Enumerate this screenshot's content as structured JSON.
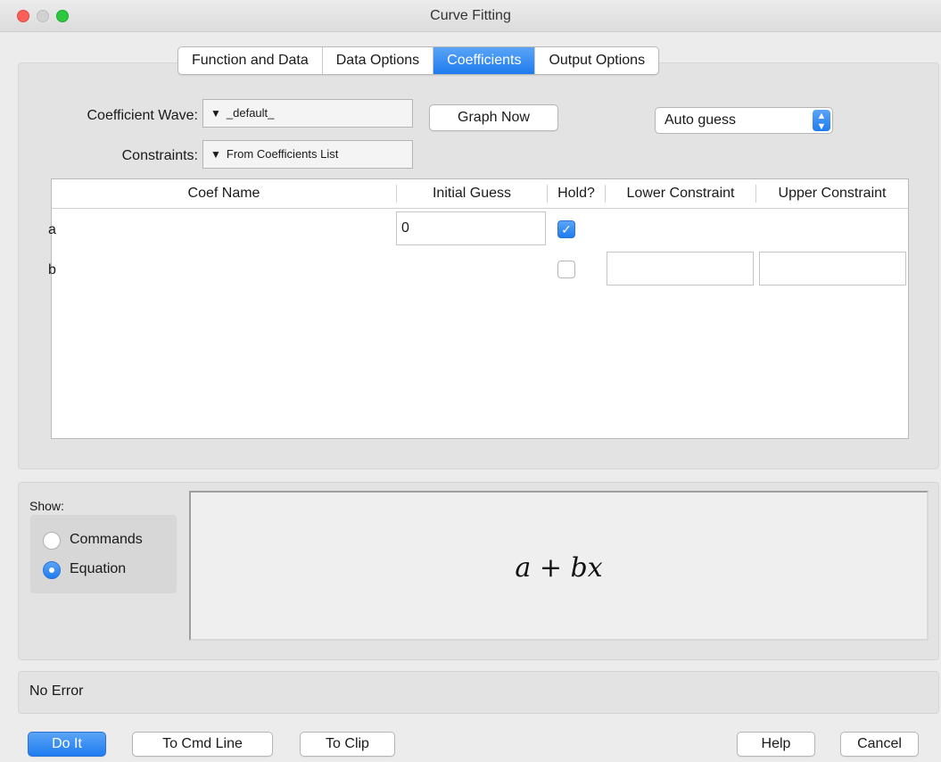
{
  "window": {
    "title": "Curve Fitting"
  },
  "tabs": [
    {
      "label": "Function and Data",
      "active": false
    },
    {
      "label": "Data Options",
      "active": false
    },
    {
      "label": "Coefficients",
      "active": true
    },
    {
      "label": "Output Options",
      "active": false
    }
  ],
  "coefficients": {
    "wave_label": "Coefficient Wave:",
    "wave_value": "_default_",
    "constraints_label": "Constraints:",
    "constraints_value": "From Coefficients List",
    "graph_now": "Graph Now",
    "guess_select": "Auto guess"
  },
  "table": {
    "headers": [
      "Coef Name",
      "Initial Guess",
      "Hold?",
      "Lower Constraint",
      "Upper Constraint"
    ],
    "rows": [
      {
        "name": "a",
        "initial_guess": "0",
        "hold": true
      },
      {
        "name": "b",
        "initial_guess": "",
        "hold": false,
        "lower": "",
        "upper": ""
      }
    ]
  },
  "show": {
    "label": "Show:",
    "options": [
      {
        "label": "Commands",
        "selected": false
      },
      {
        "label": "Equation",
        "selected": true
      }
    ]
  },
  "equation": "a + bx",
  "status": "No Error",
  "buttons": {
    "do_it": "Do It",
    "to_cmd_line": "To Cmd Line",
    "to_clip": "To Clip",
    "help": "Help",
    "cancel": "Cancel"
  },
  "colors": {
    "accent": "#1f7cf0",
    "window_bg": "#ececec"
  },
  "icons": {
    "popup": "triangle-down-icon",
    "select": "chevron-updown-icon",
    "check": "checkmark-icon"
  }
}
